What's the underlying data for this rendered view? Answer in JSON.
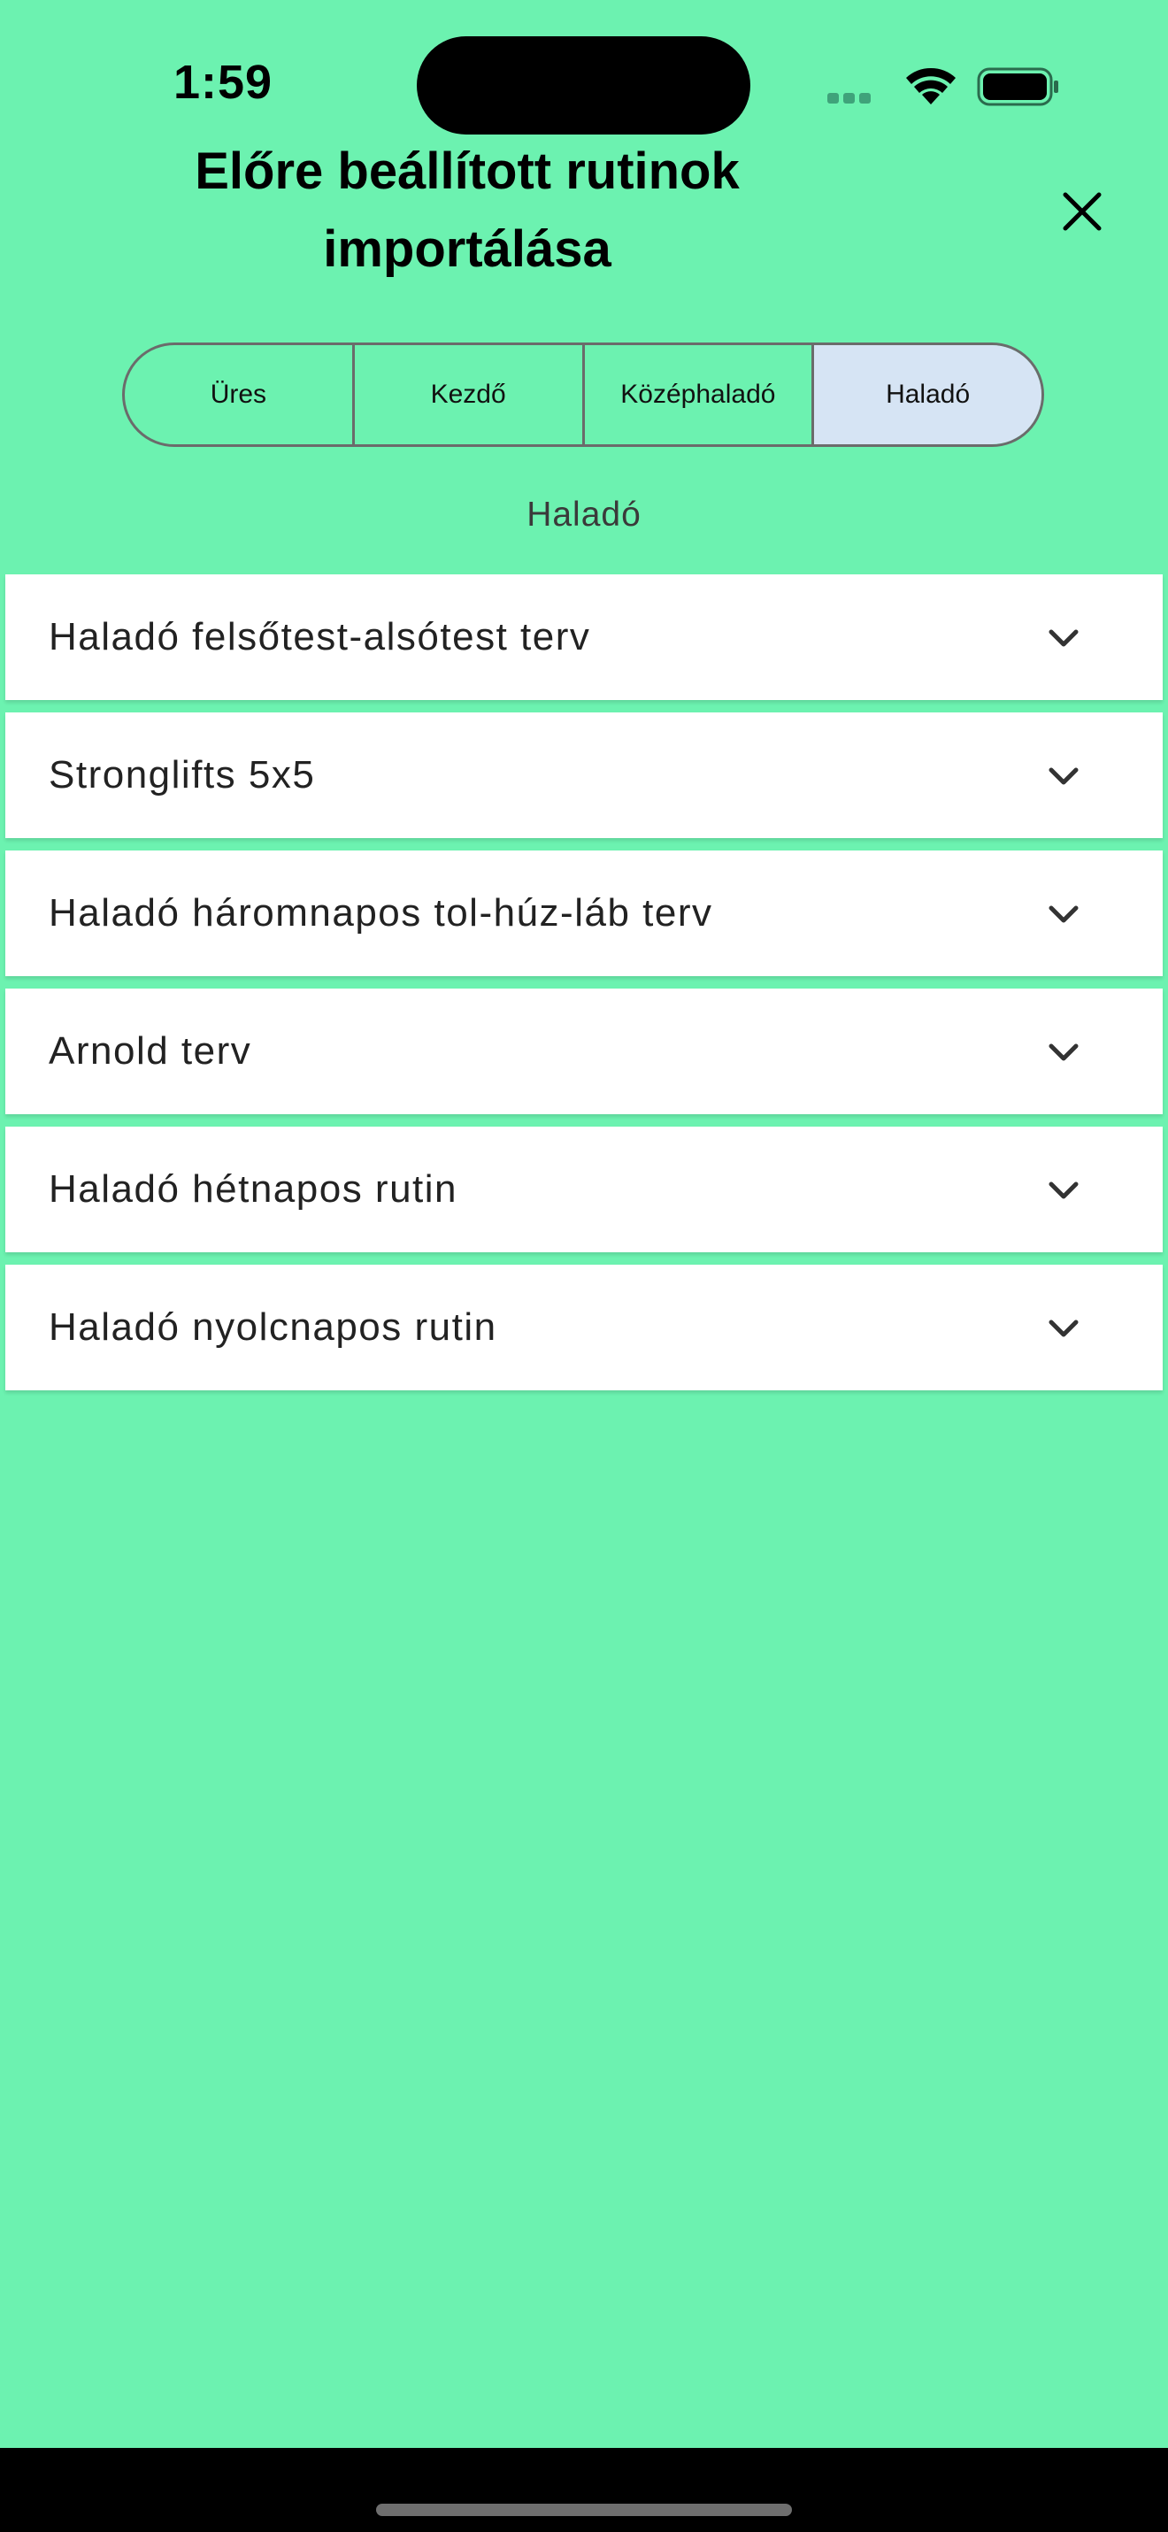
{
  "status_bar": {
    "time": "1:59"
  },
  "header": {
    "title": "Előre beállított rutinok importálása",
    "close_icon": "close-icon"
  },
  "segments": [
    {
      "label": "Üres",
      "selected": false
    },
    {
      "label": "Kezdő",
      "selected": false
    },
    {
      "label": "Középhaladó",
      "selected": false
    },
    {
      "label": "Haladó",
      "selected": true
    }
  ],
  "section": {
    "label": "Haladó"
  },
  "routines": [
    {
      "label": "Haladó felsőtest-alsótest terv"
    },
    {
      "label": "Stronglifts 5x5"
    },
    {
      "label": "Haladó háromnapos tol-húz-láb terv"
    },
    {
      "label": "Arnold terv"
    },
    {
      "label": "Haladó hétnapos rutin"
    },
    {
      "label": "Haladó nyolcnapos rutin"
    }
  ],
  "colors": {
    "background": "#6cf2b0",
    "selected_segment": "#d6e4f4",
    "card": "#ffffff"
  }
}
